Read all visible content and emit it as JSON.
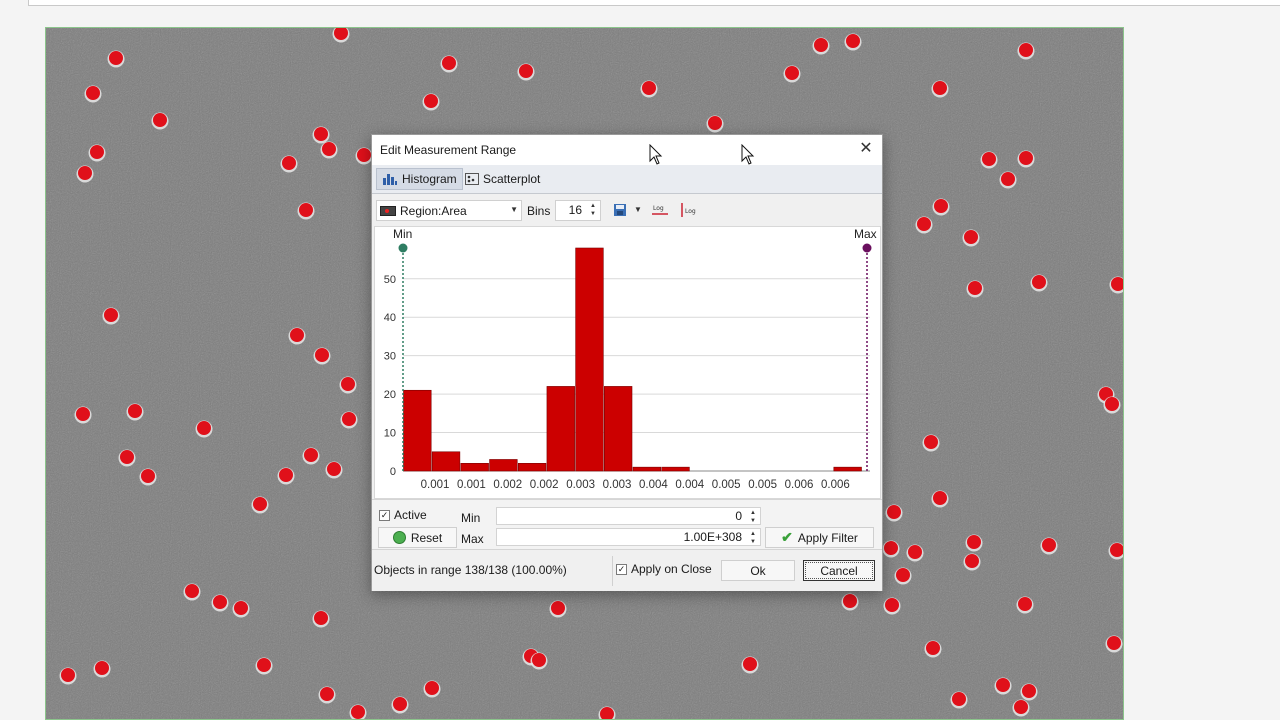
{
  "dialog": {
    "title": "Edit Measurement Range",
    "close": "✕",
    "tabs": [
      {
        "label": "Histogram",
        "active": true
      },
      {
        "label": "Scatterplot",
        "active": false
      }
    ],
    "measurement": "Region:Area",
    "bins_label": "Bins",
    "bins_value": "16",
    "active_label": "Active",
    "active_checked": true,
    "reset_label": "Reset",
    "min_label": "Min",
    "min_value": "0",
    "max_label": "Max",
    "max_value": "1.00E+308",
    "apply_filter_label": "Apply Filter",
    "objects_in_range": "Objects in range 138/138 (100.00%)",
    "apply_on_close_label": "Apply on Close",
    "apply_on_close_checked": true,
    "ok_label": "Ok",
    "cancel_label": "Cancel"
  },
  "chart_data": {
    "type": "bar",
    "categories": [
      "0.001",
      "0.001",
      "0.002",
      "0.002",
      "0.003",
      "0.003",
      "0.004",
      "0.004",
      "0.005",
      "0.005",
      "0.006",
      "0.006"
    ],
    "bins": 16,
    "values": [
      21,
      5,
      2,
      3,
      2,
      22,
      58,
      22,
      1,
      1,
      0,
      0,
      0,
      0,
      0,
      1
    ],
    "yticks": [
      0,
      10,
      20,
      30,
      40,
      50
    ],
    "ylim": [
      0,
      60
    ],
    "min_marker_label": "Min",
    "max_marker_label": "Max",
    "bar_color": "#cc0000",
    "grid": true
  },
  "colors": {
    "bar": "#cc0000",
    "min_marker": "#2e7d62",
    "max_marker": "#6a0f5e",
    "particle": "#e0101a",
    "background_image": "#7d7d7d"
  }
}
